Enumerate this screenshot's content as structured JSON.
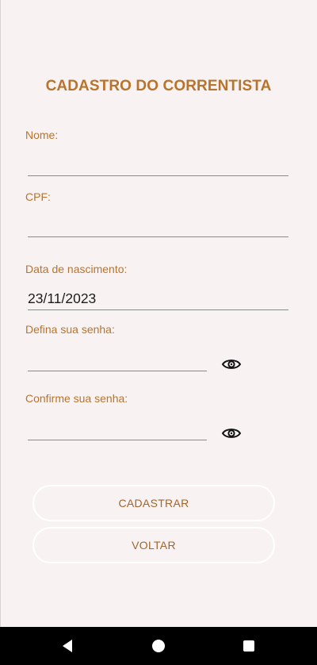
{
  "form": {
    "title": "CADASTRO DO CORRENTISTA",
    "name_label": "Nome:",
    "name_value": "",
    "cpf_label": "CPF:",
    "cpf_value": "",
    "birth_label": "Data de nascimento:",
    "birth_value": "23/11/2023",
    "password_label": "Defina sua senha:",
    "password_value": "",
    "confirm_label": "Confirme sua senha:",
    "confirm_value": ""
  },
  "buttons": {
    "register_label": "CADASTRAR",
    "back_label": "VOLTAR"
  },
  "icons": {
    "password_toggle": "eye-icon",
    "confirm_toggle": "eye-icon",
    "nav_back": "triangle-back-icon",
    "nav_home": "circle-home-icon",
    "nav_recents": "square-recents-icon"
  },
  "colors": {
    "background": "#f8f3f2",
    "accent": "#b8732c",
    "button_text": "#a4642a",
    "navbar": "#000000"
  }
}
